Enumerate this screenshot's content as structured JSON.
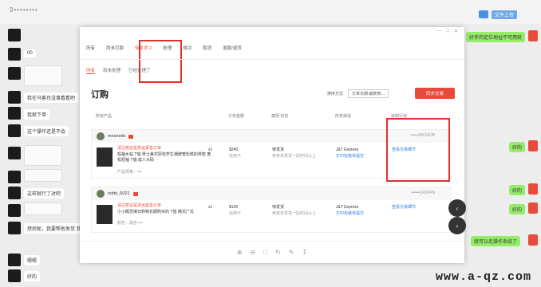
{
  "chat": {
    "title": "9••••••••",
    "cloud_label": "文件上传",
    "messages_left": [
      "00",
      "我在马客也没事看看吧",
      "我就下单",
      "这个操作还是不会",
      "这样就行了对吧",
      "然后呢，我要帮他发货 我按",
      "嗯嗯",
      "好的"
    ],
    "messages_right": [
      "好手的定位地址不可用就",
      "好的",
      "好的",
      "好的",
      "就可以走操作系统了"
    ]
  },
  "modal": {
    "tabs": [
      "所有",
      "尚未打款",
      "待发货 2",
      "处理",
      "成功",
      "取消",
      "退款/退货"
    ],
    "subtabs": [
      "所有",
      "尚未处理",
      "已经处理了"
    ],
    "title": "订购",
    "sort_label": "排序方式",
    "sort_value": "订单日期-最新到...",
    "sync_button": "同步交易",
    "columns": [
      "所有产品",
      "订单金额",
      "案例 状态",
      "所有渠道",
      "采购行动"
    ],
    "orders": [
      {
        "user": "mesneds",
        "order_id": "••••••DK1WJB",
        "promo": "请注意这是货运紧急订单",
        "product": "短袖水钻 T恤 男士美式原包学生潮牌宽松燃的男款 宽松短袖 T恤 成人大码",
        "spec": "产品规格：•••",
        "qty": "x1",
        "amount": "$240",
        "payment": "信用卡",
        "status": "待发货",
        "status_note": "卖家未发货一段时间以上",
        "channel": "J&T Express",
        "channel_action": "打印包装单提交",
        "action": "查看交易细节"
      },
      {
        "user": "notto_6021",
        "order_id": "••••••C43VFN",
        "promo": "请注意这是货运紧急订单",
        "product": "小小概念接日购物长期购买的 T恤 韩式广式",
        "spec": "颜色：黑色 •••",
        "qty": "x1",
        "amount": "$135",
        "payment": "信用卡",
        "status": "待发货",
        "status_note": "卖家未发货一段时间以上",
        "channel": "J&T Express",
        "channel_action": "打印包装单提交",
        "action": "查看交易细节"
      }
    ]
  },
  "watermark": "www.a-qz.com"
}
